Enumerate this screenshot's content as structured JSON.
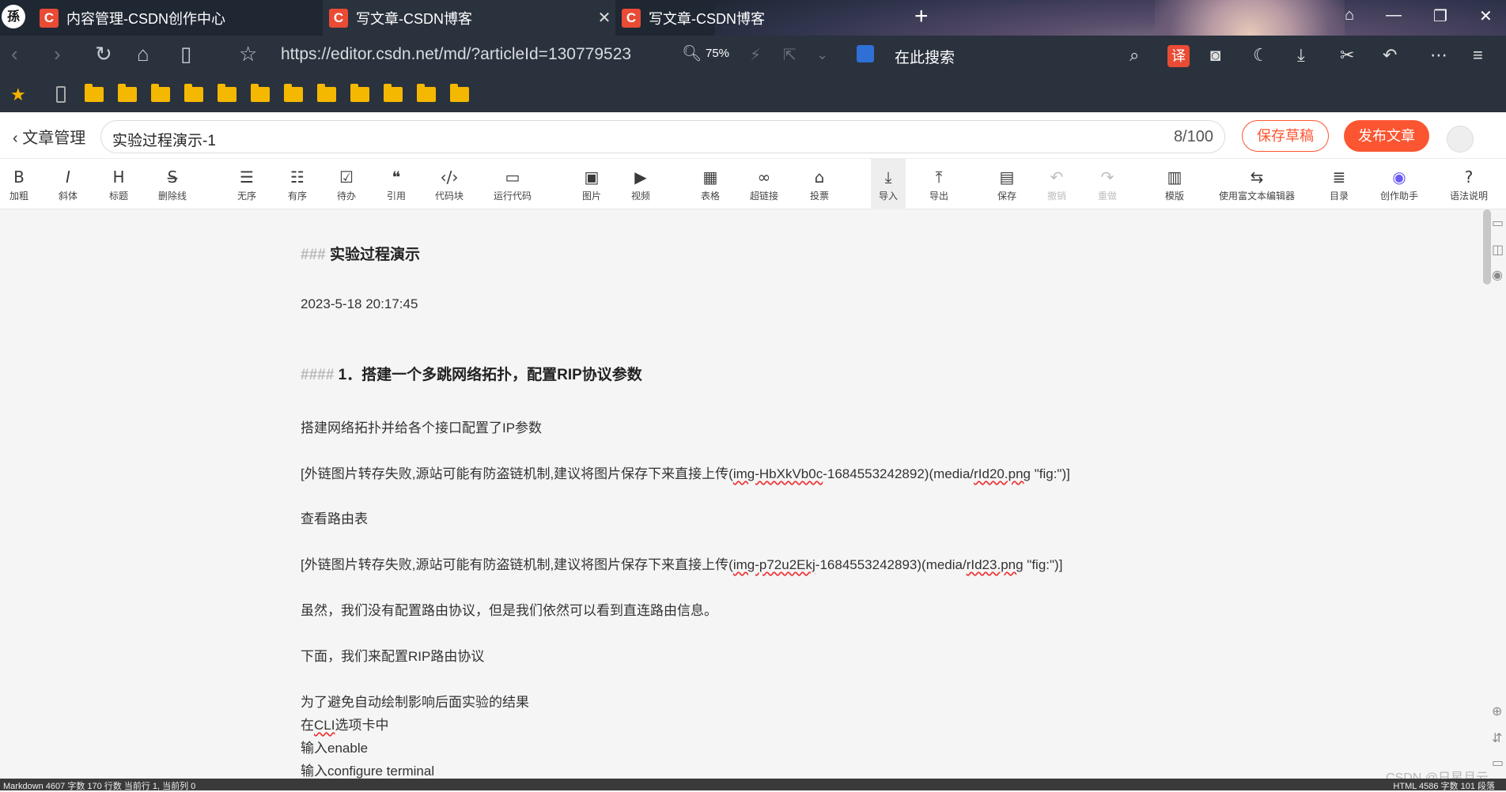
{
  "browser": {
    "logo_char": "孫",
    "tabs": [
      {
        "favicon": "C",
        "title": "内容管理-CSDN创作中心",
        "close": ""
      },
      {
        "favicon": "C",
        "title": "写文章-CSDN博客",
        "close": "✕"
      },
      {
        "favicon": "C",
        "title": "写文章-CSDN博客",
        "close": ""
      }
    ],
    "new_tab": "+",
    "url": "https://editor.csdn.net/md/?articleId=130779523",
    "zoom": "75%",
    "search_placeholder": "在此搜索",
    "translate_label": "译"
  },
  "editor": {
    "back_label": "文章管理",
    "title": "实验过程演示-1",
    "title_count": "8/100",
    "save_draft": "保存草稿",
    "publish": "发布文章"
  },
  "toolbar": [
    {
      "icon": "B",
      "label": "加粗"
    },
    {
      "icon": "I",
      "label": "斜体"
    },
    {
      "icon": "H",
      "label": "标题"
    },
    {
      "icon": "S̶",
      "label": "删除线"
    },
    {
      "icon": "☰",
      "label": "无序"
    },
    {
      "icon": "☷",
      "label": "有序"
    },
    {
      "icon": "☑",
      "label": "待办"
    },
    {
      "icon": "❝",
      "label": "引用"
    },
    {
      "icon": "‹/›",
      "label": "代码块"
    },
    {
      "icon": "▭",
      "label": "运行代码"
    },
    {
      "icon": "▣",
      "label": "图片"
    },
    {
      "icon": "▶",
      "label": "视频"
    },
    {
      "icon": "▦",
      "label": "表格"
    },
    {
      "icon": "∞",
      "label": "超链接"
    },
    {
      "icon": "⌂",
      "label": "投票"
    },
    {
      "icon": "⤓",
      "label": "导入"
    },
    {
      "icon": "⤒",
      "label": "导出"
    },
    {
      "icon": "▤",
      "label": "保存"
    },
    {
      "icon": "↶",
      "label": "撤销"
    },
    {
      "icon": "↷",
      "label": "重做"
    },
    {
      "icon": "▥",
      "label": "模版"
    },
    {
      "icon": "⇆",
      "label": "使用富文本编辑器"
    },
    {
      "icon": "≣",
      "label": "目录"
    },
    {
      "icon": "◉",
      "label": "创作助手"
    },
    {
      "icon": "?",
      "label": "语法说明"
    }
  ],
  "content": {
    "h3_mark": "###",
    "h3": "实验过程演示",
    "date": "2023-5-18 20:17:45",
    "h4_mark": "####",
    "h4": "1．搭建一个多跳网络拓扑，配置RIP协议参数",
    "p1": "搭建网络拓扑并给各个接口配置了IP参数",
    "img1_prefix": "[外链图片转存失败,源站可能有防盗链机制,建议将图片保存下来直接上传(",
    "img1_id": "img-HbXkVb0c",
    "img1_mid": "-1684553242892)(media/",
    "img1_file": "rId20.png",
    "img1_suffix": " \"fig:\")]",
    "p2": "查看路由表",
    "img2_prefix": "[外链图片转存失败,源站可能有防盗链机制,建议将图片保存下来直接上传(",
    "img2_id": "img-p72u2Ekj",
    "img2_mid": "-1684553242893)(media/",
    "img2_file": "rId23.png",
    "img2_suffix": " \"fig:\")]",
    "p3": "虽然，我们没有配置路由协议，但是我们依然可以看到直连路由信息。",
    "p4": "下面，我们来配置RIP路由协议",
    "p5": "为了避免自动绘制影响后面实验的结果",
    "p6_a": "在",
    "p6_b": "CLI",
    "p6_c": "选项卡中",
    "p7": "输入enable",
    "p8": "输入configure terminal"
  },
  "status": {
    "left": "Markdown  4607 字数  170 行数  当前行 1, 当前列 0",
    "right": "HTML  4586 字数  101 段落"
  },
  "watermark": "CSDN @日星月云"
}
